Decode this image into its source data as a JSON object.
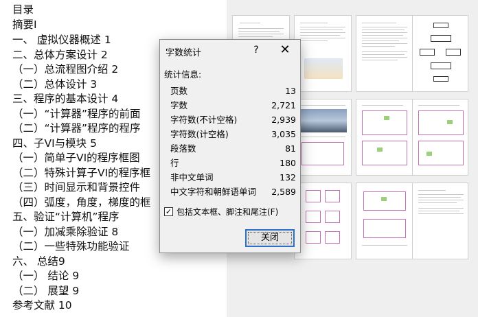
{
  "toc": {
    "lines": [
      "目录",
      "摘要I",
      "一、 虚拟仪器概述 1",
      "二、总体方案设计  2",
      "（一）总流程图介绍     2",
      "（二）总体设计     3",
      "三、程序的基本设计     4",
      "（一）“计算器”程序的前面",
      "（二）“计算器”程序的程序",
      "四、子VI与模块     5",
      "（一）简单子VI的程序框图",
      "（二）特殊计算子VI的程序框",
      "（三）时间显示和背景控件",
      "（四）弧度，角度，梯度的框",
      "五、验证“计算机”程序",
      "（一）加减乘除验证     8",
      "（二）一些特殊功能验证",
      "六、 总结9",
      "（一） 结论     9",
      "（二） 展望     9",
      "参考文献 10"
    ]
  },
  "dialog": {
    "title": "字数统计",
    "help": "?",
    "close_glyph": "✕",
    "stats_header": "统计信息:",
    "stats": [
      {
        "label": "页数",
        "value": "13"
      },
      {
        "label": "字数",
        "value": "2,721"
      },
      {
        "label": "字符数(不计空格)",
        "value": "2,939"
      },
      {
        "label": "字符数(计空格)",
        "value": "3,035"
      },
      {
        "label": "段落数",
        "value": "81"
      },
      {
        "label": "行",
        "value": "180"
      },
      {
        "label": "非中文单词",
        "value": "132"
      },
      {
        "label": "中文字符和朝鲜语单词",
        "value": "2,589"
      }
    ],
    "checkbox_label": "包括文本框、脚注和尾注(F)",
    "checkbox_checked": true,
    "checkbox_mark": "✓",
    "close_label": "关闭"
  }
}
